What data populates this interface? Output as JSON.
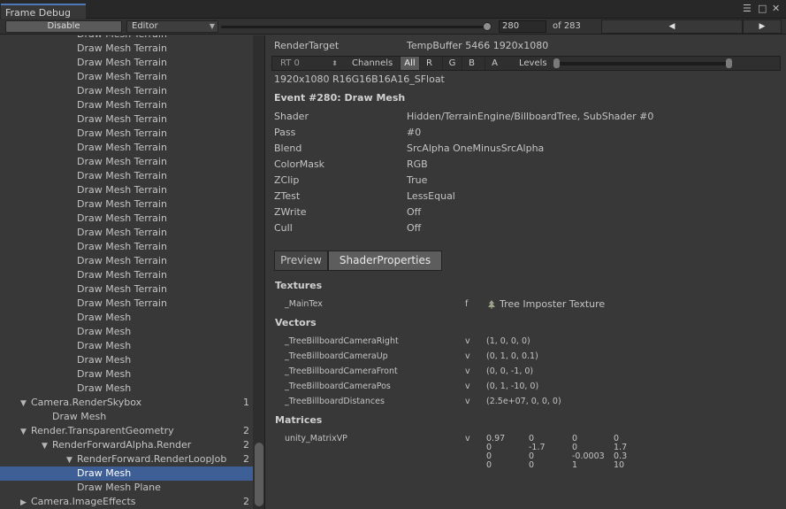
{
  "window": {
    "tab_title": "Frame Debug",
    "icons": [
      "menu-icon",
      "maximize-icon",
      "close-icon"
    ]
  },
  "toolbar": {
    "disable_label": "Disable",
    "editor_label": "Editor",
    "event_index": "280",
    "event_total_label": "of 283",
    "prev_label": "◀",
    "next_label": "▶",
    "event_progress": 0.989
  },
  "tree": {
    "partial_top_label": "Draw Mesh Terrain",
    "rows": [
      {
        "label": "Draw Mesh Terrain",
        "indent": 3
      },
      {
        "label": "Draw Mesh Terrain",
        "indent": 3
      },
      {
        "label": "Draw Mesh Terrain",
        "indent": 3
      },
      {
        "label": "Draw Mesh Terrain",
        "indent": 3
      },
      {
        "label": "Draw Mesh Terrain",
        "indent": 3
      },
      {
        "label": "Draw Mesh Terrain",
        "indent": 3
      },
      {
        "label": "Draw Mesh Terrain",
        "indent": 3
      },
      {
        "label": "Draw Mesh Terrain",
        "indent": 3
      },
      {
        "label": "Draw Mesh Terrain",
        "indent": 3
      },
      {
        "label": "Draw Mesh Terrain",
        "indent": 3
      },
      {
        "label": "Draw Mesh Terrain",
        "indent": 3
      },
      {
        "label": "Draw Mesh Terrain",
        "indent": 3
      },
      {
        "label": "Draw Mesh Terrain",
        "indent": 3
      },
      {
        "label": "Draw Mesh Terrain",
        "indent": 3
      },
      {
        "label": "Draw Mesh Terrain",
        "indent": 3
      },
      {
        "label": "Draw Mesh Terrain",
        "indent": 3
      },
      {
        "label": "Draw Mesh Terrain",
        "indent": 3
      },
      {
        "label": "Draw Mesh Terrain",
        "indent": 3
      },
      {
        "label": "Draw Mesh Terrain",
        "indent": 3
      },
      {
        "label": "Draw Mesh",
        "indent": 3
      },
      {
        "label": "Draw Mesh",
        "indent": 3
      },
      {
        "label": "Draw Mesh",
        "indent": 3
      },
      {
        "label": "Draw Mesh",
        "indent": 3
      },
      {
        "label": "Draw Mesh",
        "indent": 3
      },
      {
        "label": "Draw Mesh",
        "indent": 3
      },
      {
        "label": "Camera.RenderSkybox",
        "indent": 1,
        "expanded": true,
        "count": "1"
      },
      {
        "label": "Draw Mesh",
        "indent": 2
      },
      {
        "label": "Render.TransparentGeometry",
        "indent": 1,
        "expanded": true,
        "count": "2"
      },
      {
        "label": "RenderForwardAlpha.Render",
        "indent": 2,
        "expanded": true,
        "count": "2"
      },
      {
        "label": "RenderForward.RenderLoopJob",
        "indent": 3,
        "expanded": true,
        "count": "2"
      },
      {
        "label": "Draw Mesh",
        "indent": 3,
        "selected": true
      },
      {
        "label": "Draw Mesh Plane",
        "indent": 3
      },
      {
        "label": "Camera.ImageEffects",
        "indent": 1,
        "expanded": false,
        "count": "2"
      }
    ]
  },
  "details": {
    "render_target_label": "RenderTarget",
    "render_target_value": "TempBuffer 5466 1920x1080",
    "rt_select": "RT 0",
    "channels_label": "Channels",
    "channels": [
      "All",
      "R",
      "G",
      "B",
      "A"
    ],
    "active_channel": "All",
    "levels_label": "Levels",
    "format": "1920x1080 R16G16B16A16_SFloat",
    "event_title": "Event #280: Draw Mesh",
    "state": [
      {
        "key": "Shader",
        "value": "Hidden/TerrainEngine/BillboardTree, SubShader #0"
      },
      {
        "key": "Pass",
        "value": "#0"
      },
      {
        "key": "Blend",
        "value": "SrcAlpha OneMinusSrcAlpha"
      },
      {
        "key": "ColorMask",
        "value": "RGB"
      },
      {
        "key": "ZClip",
        "value": "True"
      },
      {
        "key": "ZTest",
        "value": "LessEqual"
      },
      {
        "key": "ZWrite",
        "value": "Off"
      },
      {
        "key": "Cull",
        "value": "Off"
      }
    ],
    "tabs": [
      "Preview",
      "ShaderProperties"
    ],
    "active_tab": "ShaderProperties",
    "textures_heading": "Textures",
    "textures": [
      {
        "name": "_MainTex",
        "type": "f",
        "value": "Tree Imposter Texture",
        "icon": "texture-icon"
      }
    ],
    "vectors_heading": "Vectors",
    "vectors": [
      {
        "name": "_TreeBillboardCameraRight",
        "type": "v",
        "value": "(1, 0, 0, 0)"
      },
      {
        "name": "_TreeBillboardCameraUp",
        "type": "v",
        "value": "(0, 1, 0, 0.1)"
      },
      {
        "name": "_TreeBillboardCameraFront",
        "type": "v",
        "value": "(0, 0, -1, 0)"
      },
      {
        "name": "_TreeBillboardCameraPos",
        "type": "v",
        "value": "(0, 1, -10, 0)"
      },
      {
        "name": "_TreeBillboardDistances",
        "type": "v",
        "value": "(2.5e+07, 0, 0, 0)"
      }
    ],
    "matrices_heading": "Matrices",
    "matrices": [
      {
        "name": "unity_MatrixVP",
        "type": "v",
        "rows": [
          [
            "0.97",
            "0",
            "0",
            "0"
          ],
          [
            "0",
            "-1.7",
            "0",
            "1.7"
          ],
          [
            "0",
            "0",
            "-0.0003",
            "0.3"
          ],
          [
            "0",
            "0",
            "1",
            "10"
          ]
        ]
      }
    ]
  }
}
